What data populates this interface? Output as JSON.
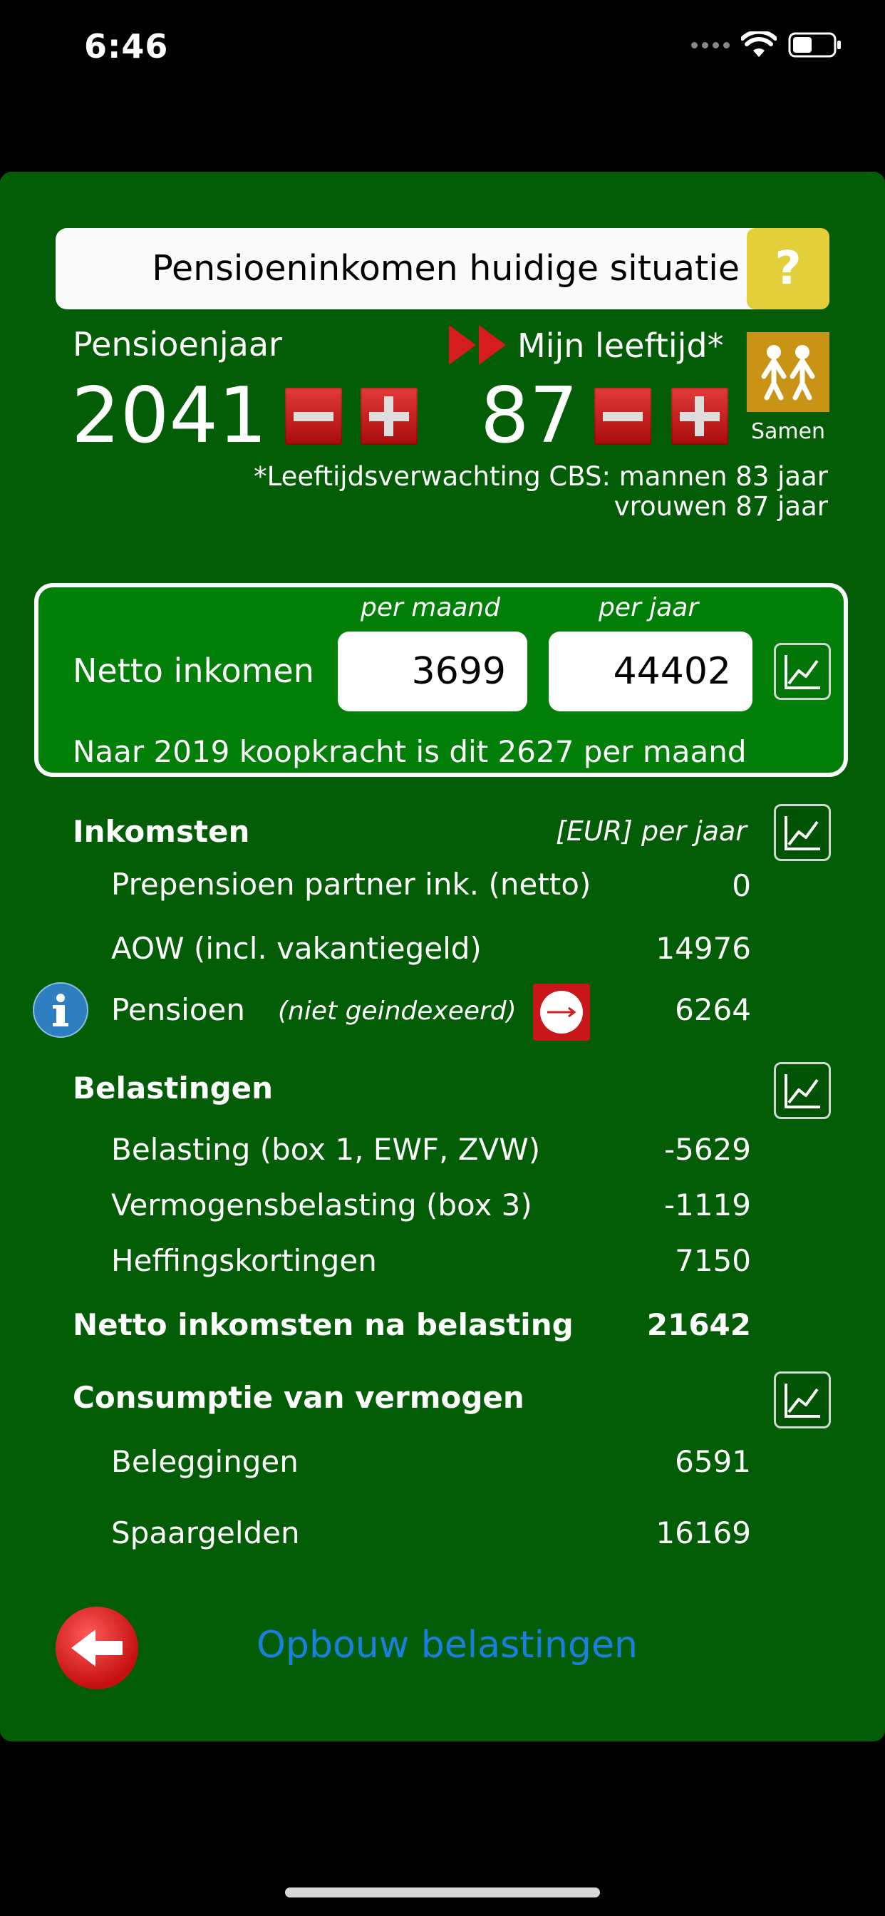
{
  "status": {
    "time": "6:46"
  },
  "header": {
    "title": "Pensioeninkomen huidige situatie",
    "help_label": "?"
  },
  "controls": {
    "pension_year_label": "Pensioenjaar",
    "pension_year": "2041",
    "age_label": "Mijn leeftijd*",
    "age": "87",
    "samen_label": "Samen",
    "cbs_line1": "*Leeftijdsverwachting CBS: mannen  83 jaar",
    "cbs_line2": "vrouwen 87 jaar"
  },
  "netto": {
    "label": "Netto inkomen",
    "per_month_label": "per maand",
    "per_year_label": "per jaar",
    "per_month": "3699",
    "per_year": "44402",
    "koopkracht": "Naar 2019 koopkracht is dit 2627 per maand"
  },
  "inkomsten": {
    "title": "Inkomsten",
    "unit": "[EUR] per jaar",
    "rows": [
      {
        "label": "Prepensioen partner ink. (netto)",
        "value": "0"
      },
      {
        "label": "AOW (incl. vakantiegeld)",
        "value": "14976"
      },
      {
        "label": "Pensioen",
        "note": "(niet geindexeerd)",
        "value": "6264"
      }
    ]
  },
  "belastingen": {
    "title": "Belastingen",
    "rows": [
      {
        "label": "Belasting (box 1, EWF, ZVW)",
        "value": "-5629"
      },
      {
        "label": "Vermogensbelasting (box 3)",
        "value": "-1119"
      },
      {
        "label": "Heffingskortingen",
        "value": "7150"
      }
    ]
  },
  "netto_na_belasting": {
    "label": "Netto inkomsten na belasting",
    "value": "21642"
  },
  "consumptie": {
    "title": "Consumptie van vermogen",
    "rows": [
      {
        "label": "Beleggingen",
        "value": "6591"
      },
      {
        "label": "Spaargelden",
        "value": "16169"
      }
    ]
  },
  "footer": {
    "nav_label": "Opbouw belastingen"
  },
  "colors": {
    "panel": "#035c06",
    "netto_box": "#027f08",
    "link": "#1a7fe0",
    "help": "#e3cf3a",
    "samen": "#c99415"
  }
}
